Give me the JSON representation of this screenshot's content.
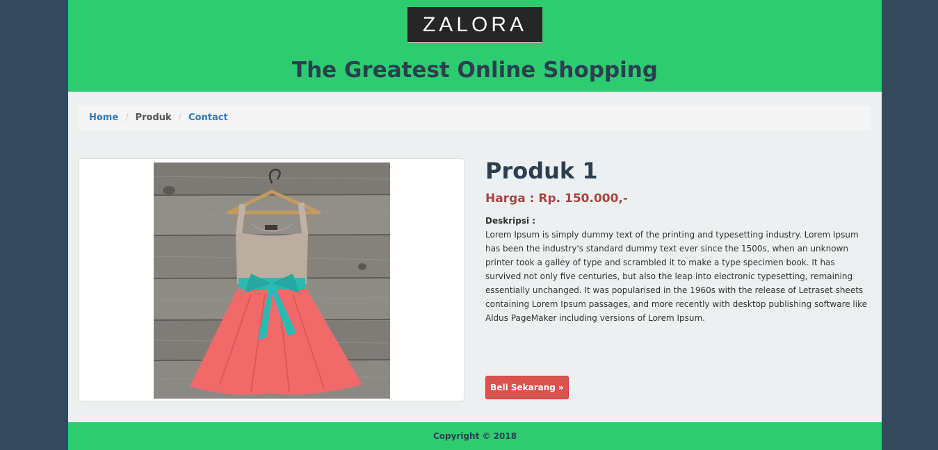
{
  "brand": {
    "logo_text": "ZALORA",
    "tagline": "The Greatest Online Shopping"
  },
  "breadcrumb": {
    "items": [
      {
        "label": "Home"
      },
      {
        "label": "Produk"
      },
      {
        "label": "Contact"
      }
    ],
    "separator": "/"
  },
  "product": {
    "name": "Produk 1",
    "price": "Harga : Rp. 150.000,-",
    "description_label": "Deskripsi :",
    "description": "Lorem Ipsum is simply dummy text of the printing and typesetting industry. Lorem Ipsum has been the industry's standard dummy text ever since the 1500s, when an unknown printer took a galley of type and scrambled it to make a type specimen book. It has survived not only five centuries, but also the leap into electronic typesetting, remaining essentially unchanged. It was popularised in the 1960s with the release of Letraset sheets containing Lorem Ipsum passages, and more recently with desktop publishing software like Aldus PageMaker including versions of Lorem Ipsum.",
    "buy_label": "Beli Sekarang »"
  },
  "footer": {
    "copyright": "Copyright © 2018"
  },
  "colors": {
    "header_bg": "#2ecc71",
    "page_bg": "#34495e",
    "price": "#a94442",
    "button": "#d9534f"
  }
}
